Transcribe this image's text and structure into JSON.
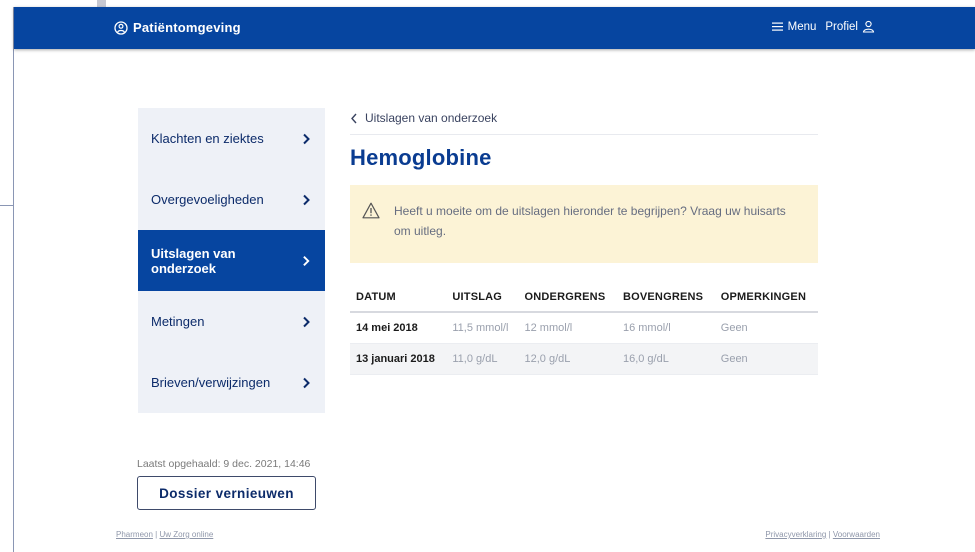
{
  "header": {
    "brand": "Patiëntomgeving",
    "menu_label": "Menu",
    "profile_label": "Profiel",
    "brand_icon": "brand-logo-icon",
    "menu_icon": "hamburger-icon",
    "profile_icon": "user-icon",
    "background_color": "#0645a0"
  },
  "sidebar": {
    "items": [
      {
        "label": "Klachten en ziektes",
        "active": false
      },
      {
        "label": "Overgevoeligheden",
        "active": false
      },
      {
        "label": "Uitslagen van onderzoek",
        "active": true
      },
      {
        "label": "Metingen",
        "active": false
      },
      {
        "label": "Brieven/verwijzingen",
        "active": false
      }
    ],
    "last_fetched": "Laatst opgehaald: 9 dec. 2021, 14:46",
    "refresh_button": "Dossier vernieuwen"
  },
  "main": {
    "back_link": "Uitslagen van onderzoek",
    "title": "Hemoglobine",
    "alert_text": "Heeft u moeite om de uitslagen hieronder te begrijpen? Vraag uw huisarts om uitleg.",
    "alert_icon": "warning-triangle-icon",
    "table": {
      "headers": [
        "DATUM",
        "UITSLAG",
        "ONDERGRENS",
        "BOVENGRENS",
        "OPMERKINGEN"
      ],
      "rows": [
        [
          "14 mei 2018",
          "11,5 mmol/l",
          "12 mmol/l",
          "16 mmol/l",
          "Geen"
        ],
        [
          "13 januari 2018",
          "11,0 g/dL",
          "12,0 g/dL",
          "16,0 g/dL",
          "Geen"
        ]
      ]
    }
  },
  "footer": {
    "left_links": [
      "Pharmeon",
      "Uw Zorg online"
    ],
    "right_links": [
      "Privacyverklaring",
      "Voorwaarden"
    ],
    "separator": "|"
  }
}
